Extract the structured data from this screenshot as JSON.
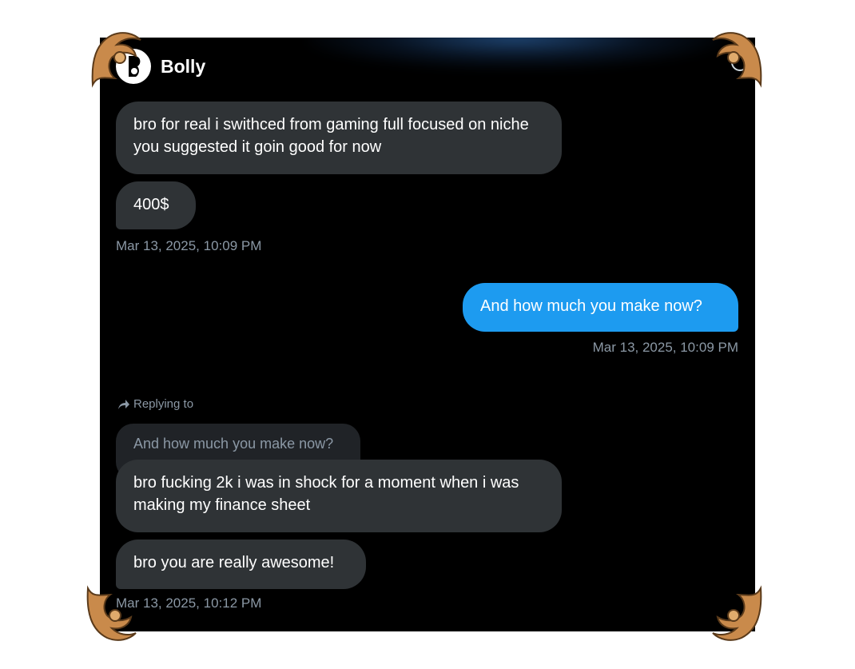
{
  "header": {
    "title": "Bolly"
  },
  "messages": {
    "m1": "bro for real i swithced from gaming full focused on niche you suggested it goin good for now",
    "m2": "400$",
    "ts1": "Mar 13, 2025, 10:09 PM",
    "m3": "And how much you make now?",
    "ts2": "Mar 13, 2025, 10:09 PM",
    "replying_label": "Replying to",
    "quoted": "And how much you make now?",
    "m4": "bro fucking 2k i was in shock for a moment when i was making my finance sheet",
    "m5": "bro you are really awesome!",
    "ts3": "Mar 13, 2025, 10:12 PM"
  },
  "colors": {
    "background": "#000000",
    "incoming_bubble": "#2f3336",
    "outgoing_bubble": "#1d9bf0",
    "timestamp": "#8b98a5",
    "ornament": "#c98a4b"
  }
}
